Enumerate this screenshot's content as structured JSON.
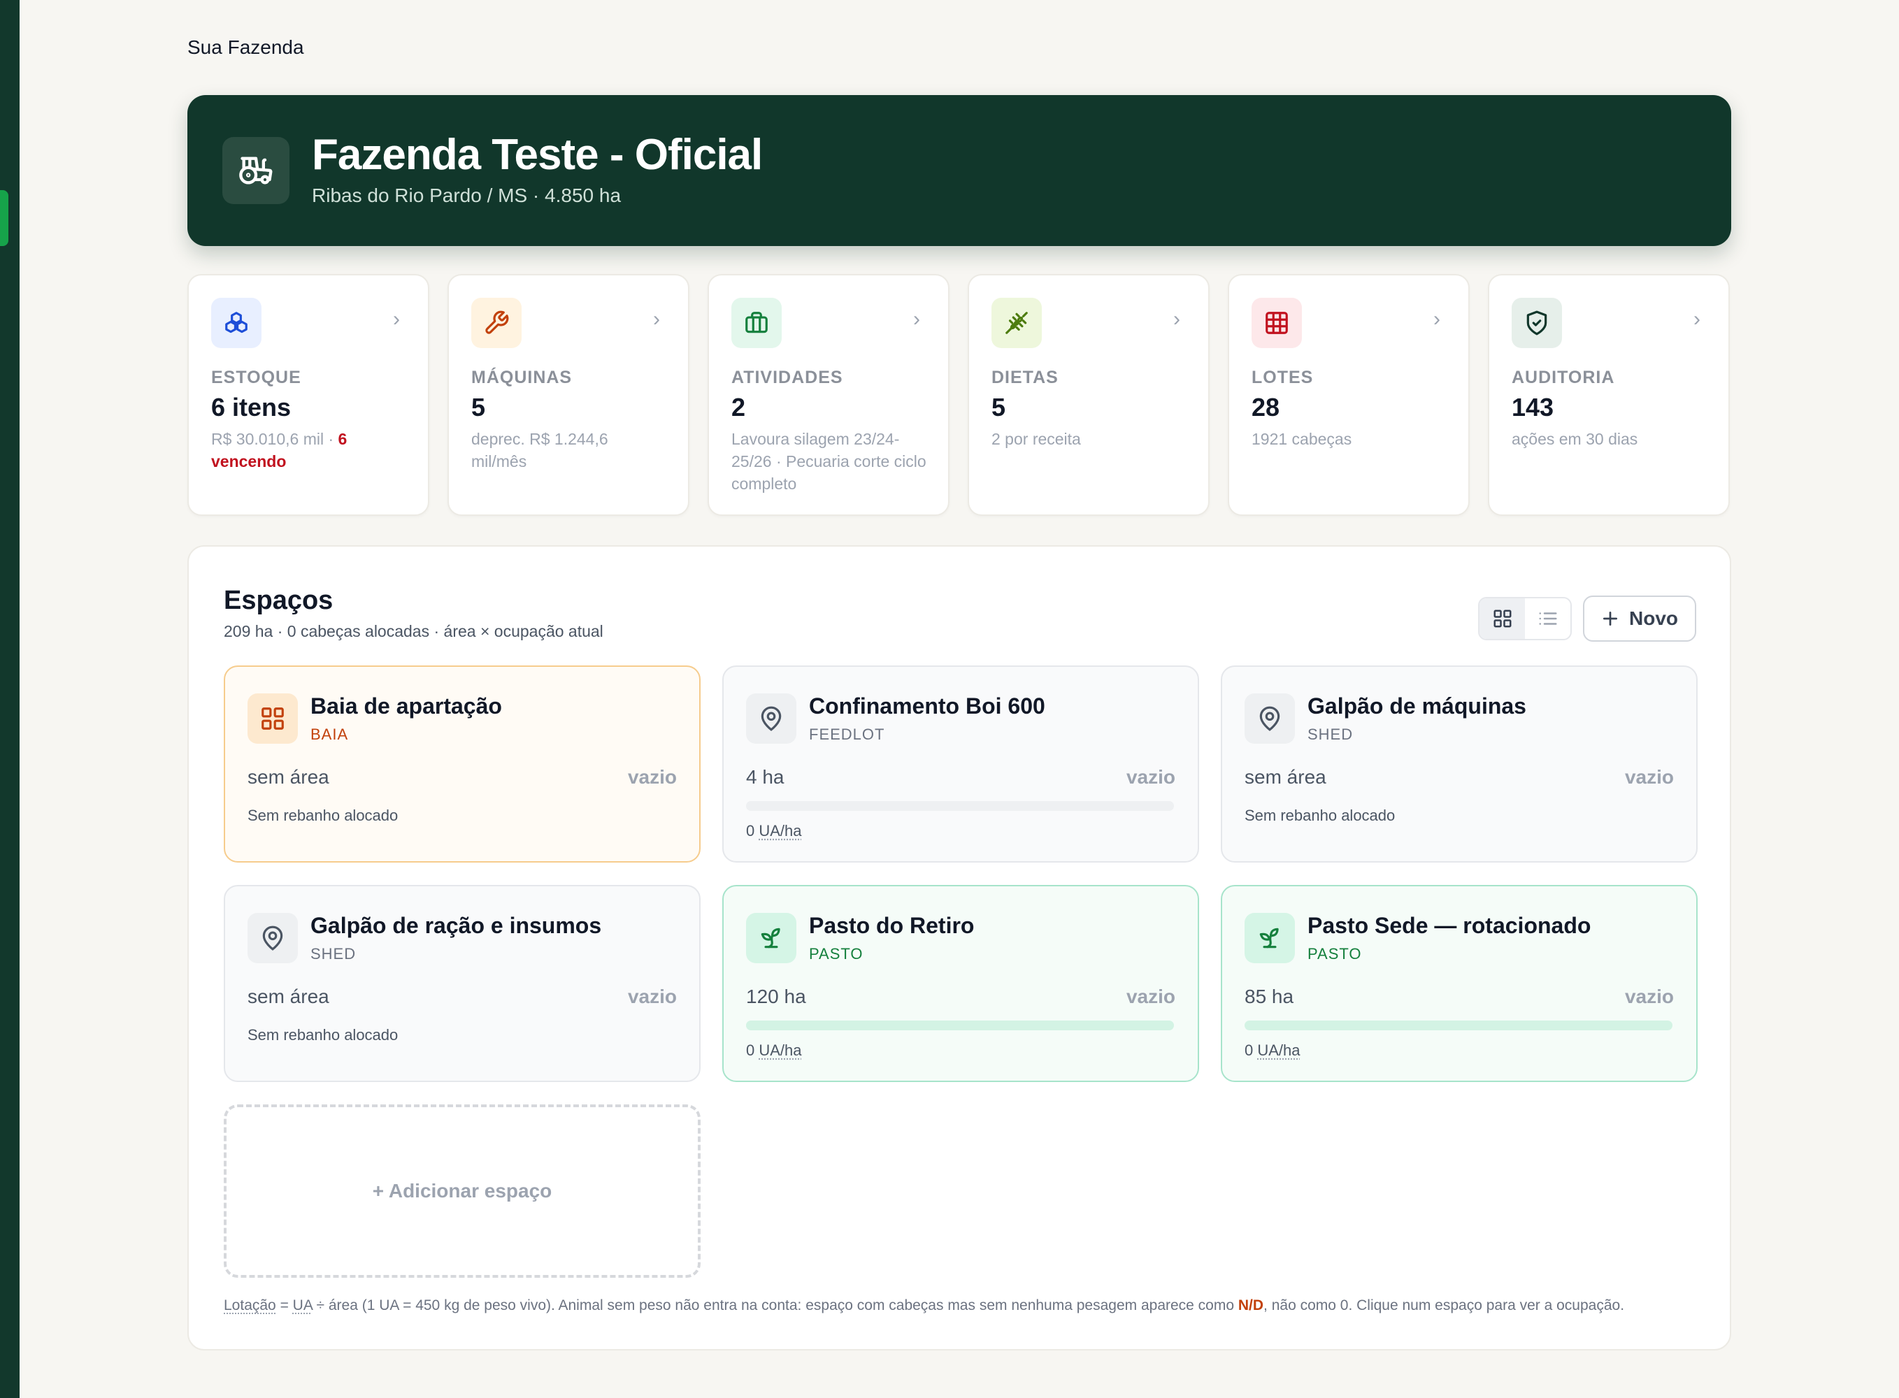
{
  "breadcrumb": "Sua Fazenda",
  "farm": {
    "title": "Fazenda Teste - Oficial",
    "subtitle": "Ribas do Rio Pardo / MS · 4.850 ha",
    "icon": "tractor-icon"
  },
  "colors": {
    "brand_dark": "#11372b",
    "accent_green": "#16a34a",
    "warning_red": "#c1121f",
    "nd_orange": "#c2410c"
  },
  "stats": [
    {
      "key": "estoque",
      "icon": "boxes-icon",
      "label": "ESTOQUE",
      "value": "6 itens",
      "detail": "R$ 30.010,6 mil · ",
      "detail_warn": "6 vencendo"
    },
    {
      "key": "maquinas",
      "icon": "wrench-icon",
      "label": "MÁQUINAS",
      "value": "5",
      "detail": "deprec. R$ 1.244,6 mil/mês"
    },
    {
      "key": "atividades",
      "icon": "briefcase-icon",
      "label": "ATIVIDADES",
      "value": "2",
      "detail": "Lavoura silagem 23/24-25/26 · Pecuaria corte ciclo completo"
    },
    {
      "key": "dietas",
      "icon": "wheat-icon",
      "label": "DIETAS",
      "value": "5",
      "detail": "2 por receita"
    },
    {
      "key": "lotes",
      "icon": "grid-icon",
      "label": "LOTES",
      "value": "28",
      "detail": "1921 cabeças"
    },
    {
      "key": "auditoria",
      "icon": "shield-check-icon",
      "label": "AUDITORIA",
      "value": "143",
      "detail": "ações em 30 dias"
    }
  ],
  "spaces": {
    "title": "Espaços",
    "subtitle": "209 ha · 0 cabeças alocadas · área × ocupação atual",
    "new_button": "Novo",
    "add_label": "+ Adicionar espaço",
    "items": [
      {
        "name": "Baia de apartação",
        "type": "BAIA",
        "icon": "layout-grid-icon",
        "area": "sem área",
        "status": "vazio",
        "note": "Sem rebanho alocado"
      },
      {
        "name": "Confinamento Boi 600",
        "type": "FEEDLOT",
        "icon": "map-pin-icon",
        "area": "4 ha",
        "status": "vazio",
        "occupancy": 0,
        "ua": "0",
        "ua_unit": "UA/ha"
      },
      {
        "name": "Galpão de máquinas",
        "type": "SHED",
        "icon": "map-pin-icon",
        "area": "sem área",
        "status": "vazio",
        "note": "Sem rebanho alocado"
      },
      {
        "name": "Galpão de ração e insumos",
        "type": "SHED",
        "icon": "map-pin-icon",
        "area": "sem área",
        "status": "vazio",
        "note": "Sem rebanho alocado"
      },
      {
        "name": "Pasto do Retiro",
        "type": "PASTO",
        "icon": "sprout-icon",
        "area": "120 ha",
        "status": "vazio",
        "occupancy": 0,
        "ua": "0",
        "ua_unit": "UA/ha"
      },
      {
        "name": "Pasto Sede — rotacionado",
        "type": "PASTO",
        "icon": "sprout-icon",
        "area": "85 ha",
        "status": "vazio",
        "occupancy": 0,
        "ua": "0",
        "ua_unit": "UA/ha"
      }
    ],
    "footnote": {
      "lotacao": "Lotação",
      "eq": " = ",
      "ua": "UA",
      "part1": " ÷ área (1 UA = 450 kg de peso vivo). Animal sem peso não entra na conta: espaço com cabeças mas sem nenhuma pesagem aparece como ",
      "nd": "N/D",
      "part2": ", não como 0. Clique num espaço para ver a ocupação."
    }
  }
}
